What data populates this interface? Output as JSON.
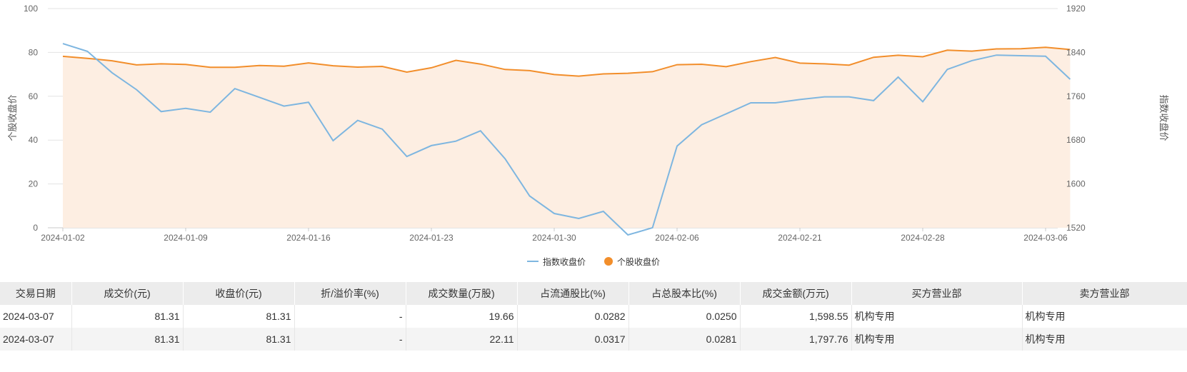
{
  "colors": {
    "index_line": "#7eb6e0",
    "stock_line": "#f28e2b",
    "stock_area": "#fdeee2",
    "grid": "#e3e3e3",
    "axis_text": "#666666"
  },
  "chart_data": {
    "type": "line",
    "ylabel": "个股收盘价",
    "y2label": "指数收盘价",
    "ylim": [
      0,
      100
    ],
    "y2lim": [
      1520,
      1920
    ],
    "yticks": [
      "0",
      "20",
      "40",
      "60",
      "80",
      "100"
    ],
    "y2ticks": [
      "1520",
      "1600",
      "1680",
      "1760",
      "1840",
      "1920"
    ],
    "xtick_labels": [
      "2024-01-02",
      "2024-01-09",
      "2024-01-16",
      "2024-01-23",
      "2024-01-30",
      "2024-02-06",
      "2024-02-21",
      "2024-02-28",
      "2024-03-06"
    ],
    "xtick_index": [
      0,
      5,
      10,
      15,
      20,
      25,
      30,
      35,
      40
    ],
    "x": [
      "2024-01-02",
      "2024-01-03",
      "2024-01-04",
      "2024-01-05",
      "2024-01-08",
      "2024-01-09",
      "2024-01-10",
      "2024-01-11",
      "2024-01-12",
      "2024-01-15",
      "2024-01-16",
      "2024-01-17",
      "2024-01-18",
      "2024-01-19",
      "2024-01-22",
      "2024-01-23",
      "2024-01-24",
      "2024-01-25",
      "2024-01-26",
      "2024-01-29",
      "2024-01-30",
      "2024-01-31",
      "2024-02-01",
      "2024-02-02",
      "2024-02-05",
      "2024-02-06",
      "2024-02-07",
      "2024-02-08",
      "2024-02-19",
      "2024-02-20",
      "2024-02-21",
      "2024-02-22",
      "2024-02-23",
      "2024-02-26",
      "2024-02-27",
      "2024-02-28",
      "2024-02-29",
      "2024-03-01",
      "2024-03-04",
      "2024-03-05",
      "2024-03-06",
      "2024-03-07"
    ],
    "series": [
      {
        "name": "指数收盘价",
        "axis": "right",
        "values": [
          1856,
          1842,
          1803,
          1772,
          1732,
          1738,
          1731,
          1774,
          1758,
          1742,
          1749,
          1679,
          1716,
          1700,
          1650,
          1670,
          1678,
          1697,
          1646,
          1578,
          1546,
          1537,
          1550,
          1507,
          1520,
          1669,
          1708,
          1728,
          1748,
          1748,
          1754,
          1759,
          1759,
          1752,
          1795,
          1750,
          1809,
          1825,
          1835,
          1834,
          1833,
          1791
        ]
      },
      {
        "name": "个股收盘价",
        "axis": "left",
        "values": [
          78.2,
          77.3,
          76.2,
          74.3,
          74.8,
          74.5,
          73.2,
          73.2,
          74.0,
          73.7,
          75.2,
          73.9,
          73.3,
          73.6,
          71.0,
          73.0,
          76.4,
          74.7,
          72.2,
          71.7,
          69.9,
          69.2,
          70.2,
          70.5,
          71.2,
          74.4,
          74.6,
          73.5,
          75.8,
          77.7,
          75.1,
          74.8,
          74.2,
          77.8,
          78.7,
          78.0,
          81.0,
          80.6,
          81.6,
          81.7,
          82.3,
          81.31
        ]
      }
    ],
    "legend_position": "bottom-center",
    "grid": true
  },
  "table": {
    "headers": [
      "交易日期",
      "成交价(元)",
      "收盘价(元)",
      "折/溢价率(%)",
      "成交数量(万股)",
      "占流通股比(%)",
      "占总股本比(%)",
      "成交金额(万元)",
      "买方营业部",
      "卖方营业部"
    ],
    "rows": [
      [
        "2024-03-07",
        "81.31",
        "81.31",
        "-",
        "19.66",
        "0.0282",
        "0.0250",
        "1,598.55",
        "机构专用",
        "机构专用"
      ],
      [
        "2024-03-07",
        "81.31",
        "81.31",
        "-",
        "22.11",
        "0.0317",
        "0.0281",
        "1,797.76",
        "机构专用",
        "机构专用"
      ]
    ]
  }
}
